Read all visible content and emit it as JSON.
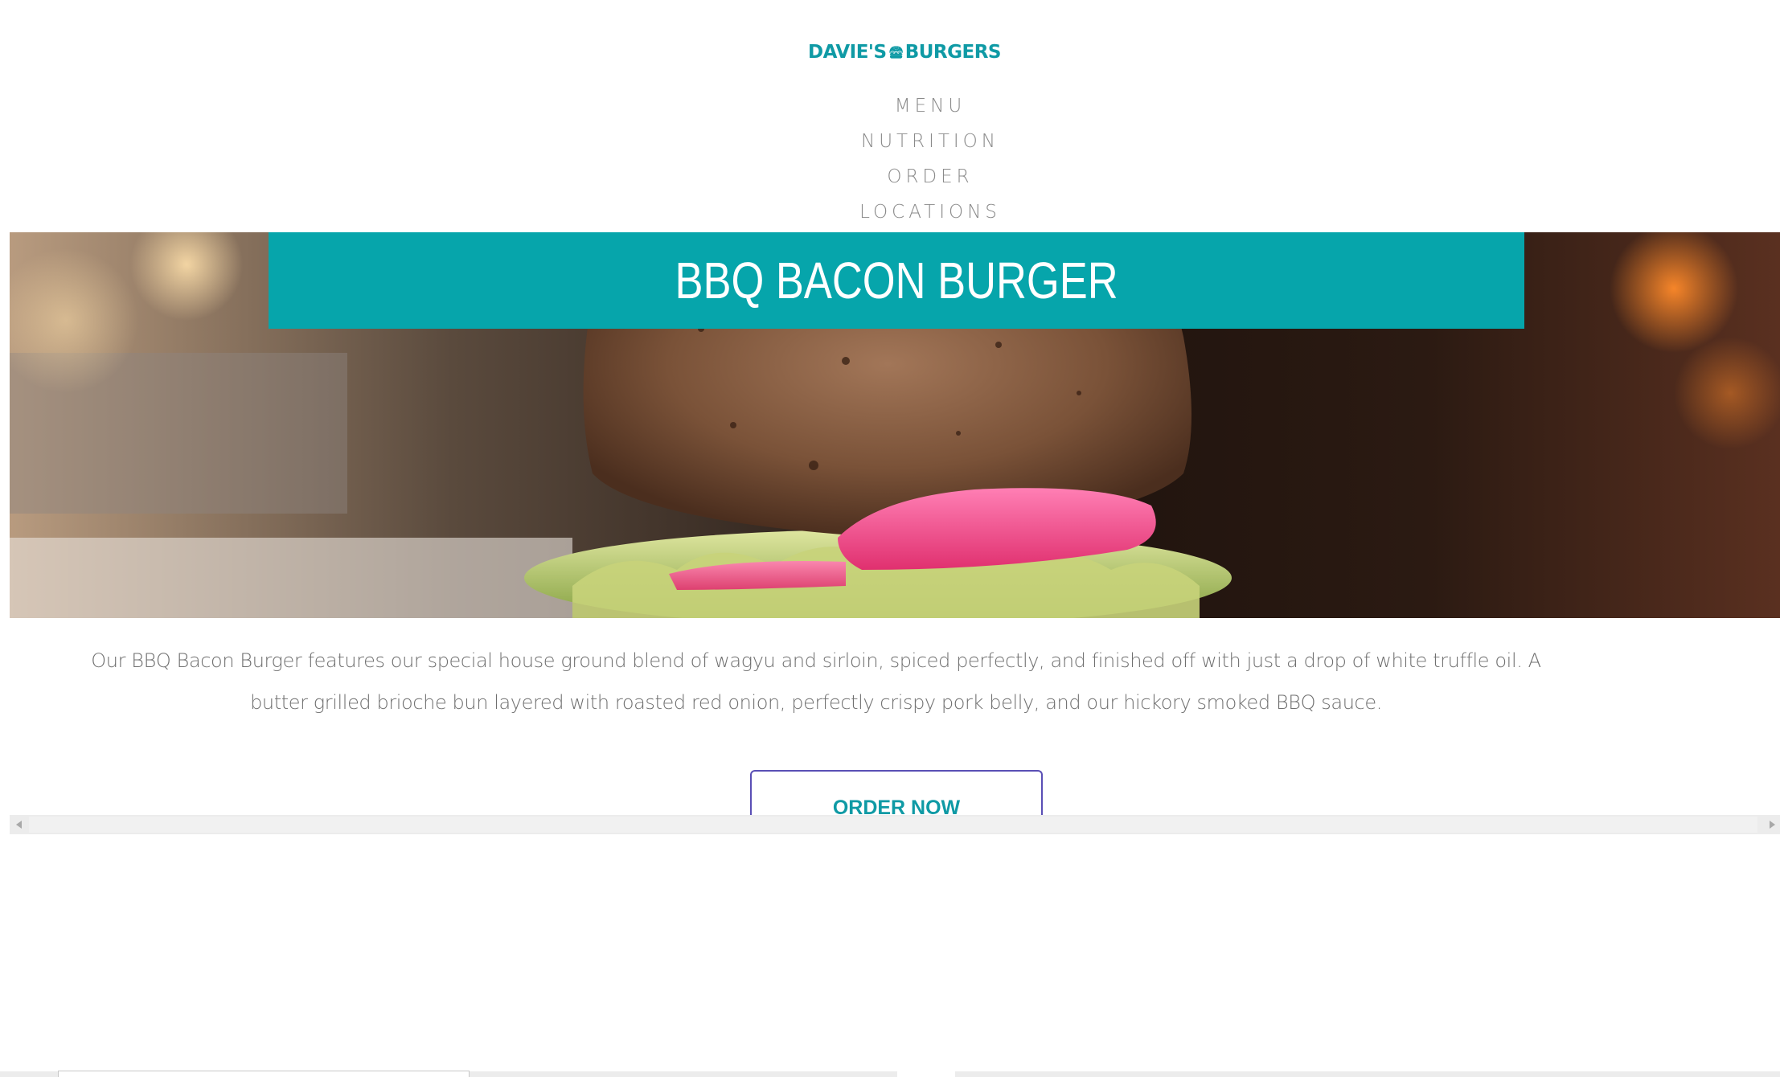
{
  "brand": {
    "left_word": "DAVIE'S",
    "right_word": "BURGERS",
    "logo_icon": "burger-bun-icon",
    "color": "#0f9aa5"
  },
  "nav": {
    "items": [
      {
        "label": "MENU"
      },
      {
        "label": "NUTRITION"
      },
      {
        "label": "ORDER"
      },
      {
        "label": "LOCATIONS"
      }
    ]
  },
  "hero": {
    "title": "BBQ BACON BURGER",
    "title_bar_color": "#06a5ab"
  },
  "description": {
    "line1": "Our BBQ Bacon Burger features our special house ground blend of wagyu and sirloin, spiced perfectly, and finished off with just a drop of white truffle oil. A",
    "line2": "butter grilled brioche bun layered with roasted red onion, perfectly crispy pork belly, and our hickory smoked BBQ sauce."
  },
  "cta": {
    "label": "ORDER NOW",
    "border_color": "#5a4fb5",
    "text_color": "#0f9aa5"
  }
}
